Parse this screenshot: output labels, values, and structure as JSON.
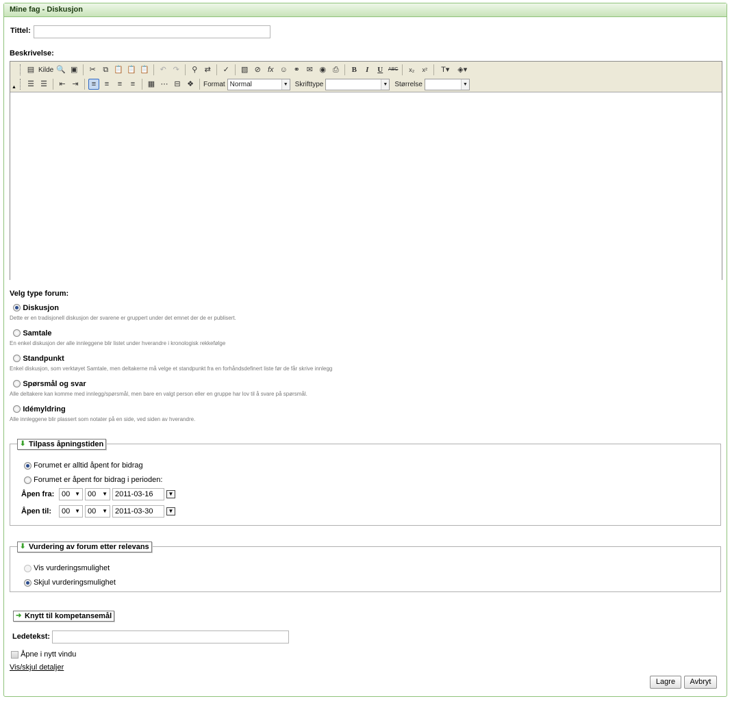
{
  "window": {
    "title": "Mine fag - Diskusjon"
  },
  "form": {
    "title_label": "Tittel:",
    "title_value": "",
    "description_label": "Beskrivelse:"
  },
  "editor": {
    "source_label": "Kilde",
    "format_label": "Format",
    "format_value": "Normal",
    "font_label": "Skrifttype",
    "font_value": "",
    "size_label": "Størrelse",
    "size_value": "",
    "bold": "B",
    "italic": "I",
    "underline": "U",
    "strike": "ABC"
  },
  "forum_type": {
    "heading": "Velg type forum:",
    "options": [
      {
        "label": "Diskusjon",
        "desc": "Dette er en tradisjonell diskusjon der svarene er gruppert under det emnet der de er publisert.",
        "selected": true
      },
      {
        "label": "Samtale",
        "desc": "En enkel diskusjon der alle innleggene blir listet under hverandre i kronologisk rekkefølge",
        "selected": false
      },
      {
        "label": "Standpunkt",
        "desc": "Enkel diskusjon, som verktøyet Samtale, men deltakerne må velge et standpunkt fra en forhåndsdefinert liste før de får skrive innlegg",
        "selected": false
      },
      {
        "label": "Spørsmål og svar",
        "desc": "Alle deltakere kan komme med innlegg/spørsmål, men bare en valgt person eller en gruppe har lov til å svare på spørsmål.",
        "selected": false
      },
      {
        "label": "Idémyldring",
        "desc": "Alle innleggene blir plassert som notater på en side, ved siden av hverandre.",
        "selected": false
      }
    ]
  },
  "opening": {
    "legend": "Tilpass åpningstiden",
    "always_open": "Forumet er alltid åpent for bidrag",
    "period_open": "Forumet er åpent for bidrag i perioden:",
    "from_label": "Åpen fra:",
    "to_label": "Åpen til:",
    "from_hour": "00",
    "from_min": "00",
    "from_date": "2011-03-16",
    "to_hour": "00",
    "to_min": "00",
    "to_date": "2011-03-30"
  },
  "rating": {
    "legend": "Vurdering av forum etter relevans",
    "show": "Vis vurderingsmulighet",
    "hide": "Skjul vurderingsmulighet"
  },
  "competence": {
    "button": "Knytt til kompetansemål",
    "prompt_label": "Ledetekst:",
    "prompt_value": "",
    "new_window": "Åpne i nytt vindu",
    "details_link": "Vis/skjul detaljer"
  },
  "actions": {
    "save": "Lagre",
    "cancel": "Avbryt"
  },
  "colors": {
    "accent": "#8fc27a",
    "arrow": "#3aa12b"
  }
}
